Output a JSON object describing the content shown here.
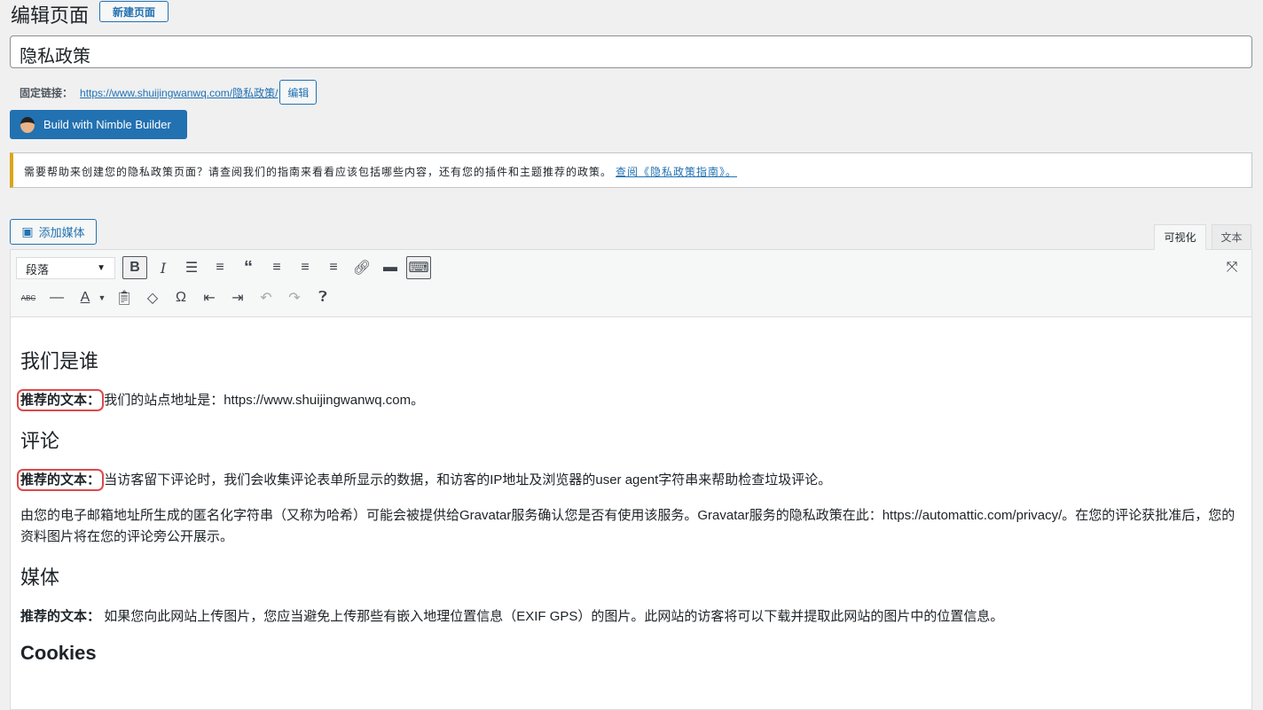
{
  "header": {
    "title": "编辑页面",
    "new_page": "新建页面"
  },
  "post_title": "隐私政策",
  "permalink": {
    "label": "固定链接：",
    "url": "https://www.shuijingwanwq.com/隐私政策/",
    "edit": "编辑"
  },
  "nimble": {
    "label": "Build with Nimble Builder"
  },
  "notice": {
    "text": "需要帮助来创建您的隐私政策页面？请查阅我们的指南来看看应该包括哪些内容，还有您的插件和主题推荐的政策。",
    "link": "查阅《隐私政策指南》。"
  },
  "media_button": "添加媒体",
  "tabs": {
    "visual": "可视化",
    "text": "文本"
  },
  "toolbar": {
    "format": "段落"
  },
  "content": {
    "h_who": "我们是谁",
    "rec": "推荐的文本：",
    "p_who": "我们的站点地址是：https://www.shuijingwanwq.com。",
    "h_comments": "评论",
    "p_comments": "当访客留下评论时，我们会收集评论表单所显示的数据，和访客的IP地址及浏览器的user agent字符串来帮助检查垃圾评论。",
    "p_gravatar": "由您的电子邮箱地址所生成的匿名化字符串（又称为哈希）可能会被提供给Gravatar服务确认您是否有使用该服务。Gravatar服务的隐私政策在此：https://automattic.com/privacy/。在您的评论获批准后，您的资料图片将在您的评论旁公开展示。",
    "h_media": "媒体",
    "p_media": "如果您向此网站上传图片，您应当避免上传那些有嵌入地理位置信息（EXIF GPS）的图片。此网站的访客将可以下载并提取此网站的图片中的位置信息。",
    "h_cookies": "Cookies"
  }
}
